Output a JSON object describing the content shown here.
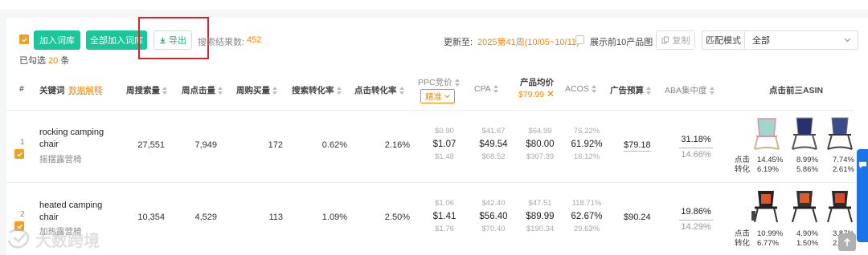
{
  "toolbar": {
    "add_lib": "加入词库",
    "add_all_lib": "全部加入词库",
    "export": "导出",
    "search_count_label": "搜索结果数:",
    "search_count": "452",
    "updated_label": "更新至:",
    "updated_value": "2025第41周(10/05~10/11)",
    "show_top10": "展示前10产品图",
    "copy": "复制",
    "match_mode_label": "匹配模式",
    "match_mode_value": "全部",
    "selected_label": "已勾选",
    "selected_count": "20",
    "selected_unit": "条"
  },
  "header": {
    "idx": "#",
    "keyword": "关键词",
    "data_explain": "数据解释",
    "weekly_search": "周搜索量",
    "weekly_clicks": "周点击量",
    "weekly_purchases": "周购买量",
    "search_cvr": "搜索转化率",
    "ctr": "点击转化率",
    "ppc": "PPC竞价",
    "ppc_mode": "精准",
    "cpa": "CPA",
    "avg_price": "产品均价",
    "avg_price_value": "$79.99",
    "acos": "ACOS",
    "ad_budget": "广告预算",
    "aba": "ABA集中度",
    "top3": "点击前三ASIN"
  },
  "rows": [
    {
      "idx": "1",
      "keyword": "rocking camping chair",
      "keyword_cn": "摇摆露营椅",
      "weekly_search": "27,551",
      "weekly_clicks": "7,949",
      "weekly_purchases": "172",
      "search_cvr": "0.62%",
      "ctr": "2.16%",
      "ppc": [
        "$0.90",
        "$1.07",
        "$1.48"
      ],
      "cpa": [
        "$41.67",
        "$49.54",
        "$68.52"
      ],
      "price": [
        "$64.99",
        "$80.00",
        "$307.39"
      ],
      "acos": [
        "76.22%",
        "61.92%",
        "16.12%"
      ],
      "budget": "$79.18",
      "aba": [
        "31.18%",
        "14.66%"
      ],
      "click_label": "点击",
      "conv_label": "转化",
      "asins": [
        {
          "click": "14.45%",
          "conv": "6.19%"
        },
        {
          "click": "8.99%",
          "conv": "5.86%"
        },
        {
          "click": "7.74%",
          "conv": "2.61%"
        }
      ]
    },
    {
      "idx": "2",
      "keyword": "heated camping chair",
      "keyword_cn": "加热露营椅",
      "weekly_search": "10,354",
      "weekly_clicks": "4,529",
      "weekly_purchases": "113",
      "search_cvr": "1.09%",
      "ctr": "2.50%",
      "ppc": [
        "$1.06",
        "$1.41",
        "$1.76"
      ],
      "cpa": [
        "$42.40",
        "$56.40",
        "$70.40"
      ],
      "price": [
        "$47.51",
        "$89.99",
        "$190.34"
      ],
      "acos": [
        "118.71%",
        "62.67%",
        "29.63%"
      ],
      "budget": "$90.24",
      "aba": [
        "19.86%",
        "14.29%"
      ],
      "click_label": "点击",
      "conv_label": "转化",
      "asins": [
        {
          "click": "10.99%",
          "conv": "6.77%"
        },
        {
          "click": "4.90%",
          "conv": "1.50%"
        },
        {
          "click": "3.87%",
          "conv": "2.77%"
        }
      ]
    }
  ],
  "watermark": "大数跨境",
  "colors": {
    "accent_green": "#19c79a",
    "orange": "#f08a00",
    "red_box": "#e0212b"
  }
}
